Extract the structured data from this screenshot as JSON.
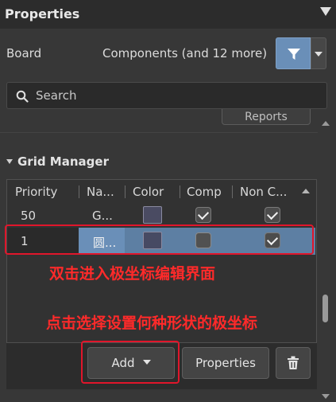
{
  "panel": {
    "title": "Properties"
  },
  "board": {
    "label": "Board",
    "selection": "Components (and 12 more)"
  },
  "search": {
    "placeholder": "Search"
  },
  "reports": {
    "label": "Reports"
  },
  "grid_manager": {
    "title": "Grid Manager",
    "columns": [
      "Priority",
      "Na...",
      "Color",
      "Comp",
      "Non C..."
    ],
    "rows": [
      {
        "priority": "50",
        "name": "G...",
        "comp": true,
        "non_comp": true
      },
      {
        "priority": "1",
        "name": "圆...",
        "comp": false,
        "non_comp": true
      }
    ]
  },
  "annotations": {
    "line1": "双击进入极坐标编辑界面",
    "line2": "点击选择设置何种形状的极坐标"
  },
  "buttons": {
    "add": "Add",
    "properties": "Properties"
  },
  "colors": {
    "highlight": "#e0162b",
    "accent": "#6a8fb8",
    "selected_row": "#5d7fa3"
  },
  "icons": [
    "filter-icon",
    "search-icon",
    "trash-icon",
    "chevron-down-icon"
  ]
}
